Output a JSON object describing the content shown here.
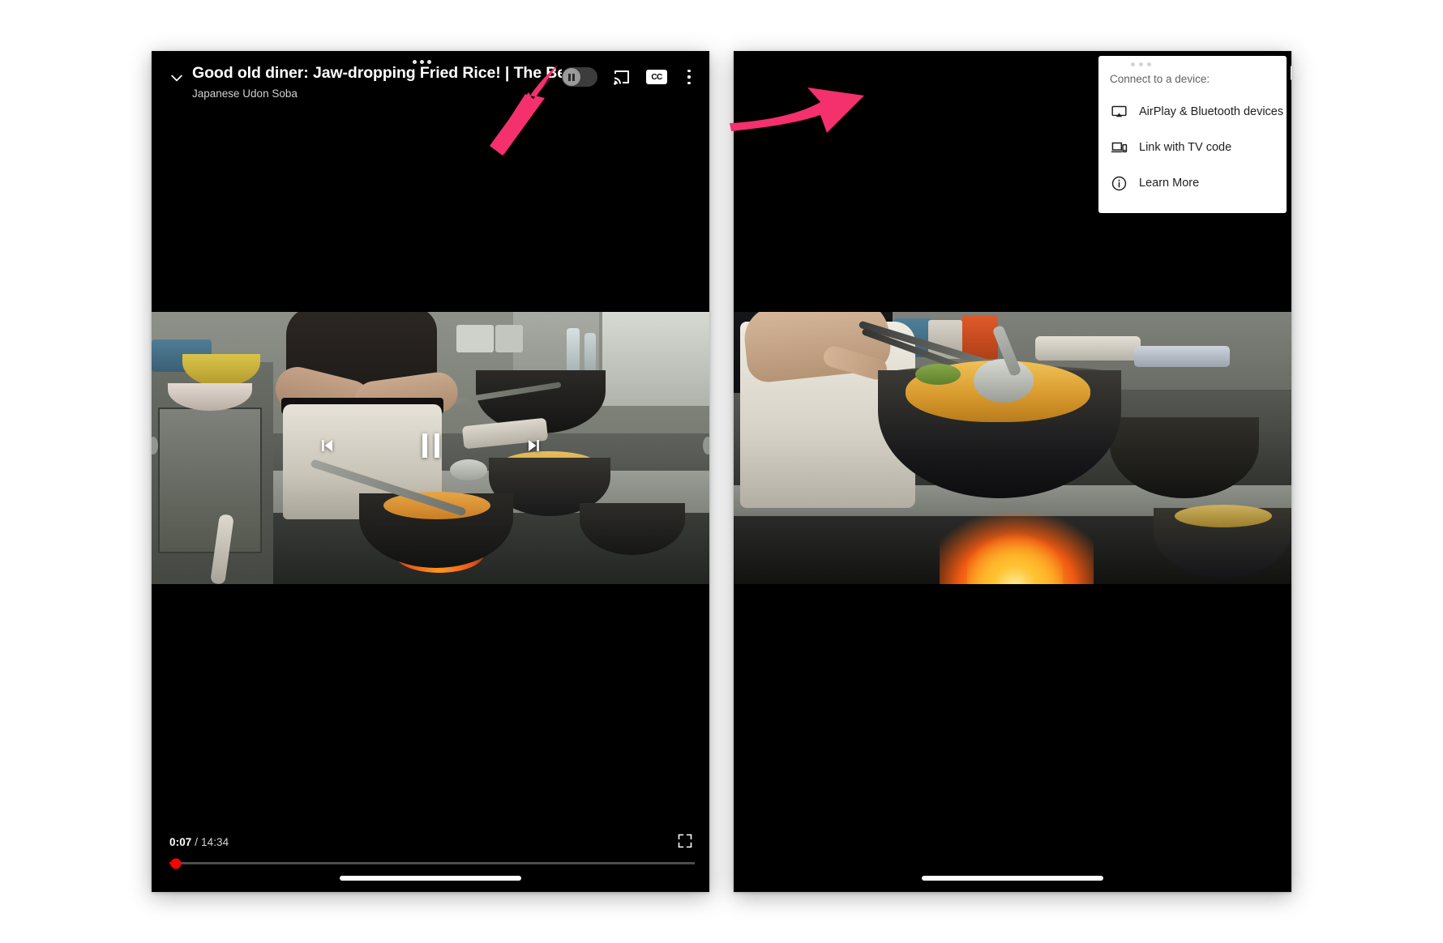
{
  "annotation": {
    "arrow_color": "#f4306d",
    "arrows": [
      {
        "name": "arrow-to-cast-button",
        "target": "cast-icon"
      },
      {
        "name": "arrow-to-airplay-item",
        "target": "AirPlay & Bluetooth devices"
      }
    ]
  },
  "left_phone": {
    "player": {
      "collapse_icon": "chevron-down-icon",
      "title": "Good old diner: Jaw-dropping Fried Rice! | The Best Chinese C...",
      "channel": "Japanese Udon Soba",
      "loading_dots": "loading-dots",
      "autoplay_toggle": {
        "name": "pause-toggle",
        "state": "paused"
      },
      "cast_icon": "cast-icon",
      "captions_label": "CC",
      "more_icon": "kebab-menu-icon",
      "controls": {
        "previous_label": "previous-video",
        "pause_label": "pause",
        "next_label": "next-video"
      },
      "current_time": "0:07",
      "separator": " / ",
      "total_time": "14:34",
      "progress_percent": 1.2,
      "fullscreen_icon": "fullscreen-icon"
    }
  },
  "right_phone": {
    "cast_menu": {
      "header": "Connect to a device:",
      "items": [
        {
          "icon": "airplay-icon",
          "label": "AirPlay & Bluetooth devices"
        },
        {
          "icon": "tv-code-icon",
          "label": "Link with TV code"
        },
        {
          "icon": "info-icon",
          "label": "Learn More"
        }
      ]
    }
  }
}
